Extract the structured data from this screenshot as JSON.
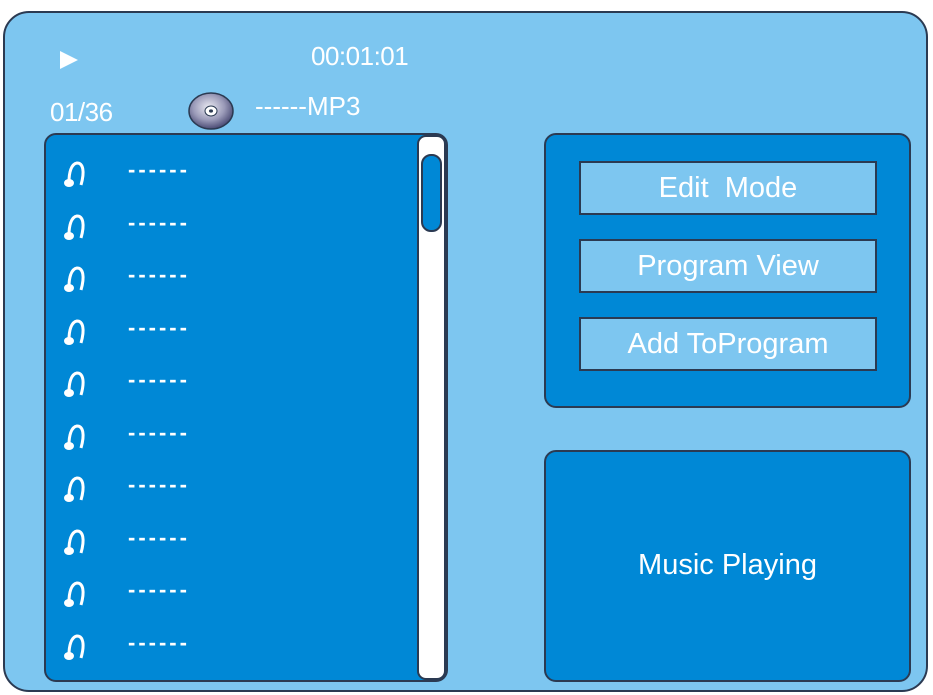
{
  "header": {
    "play_icon": "play-icon",
    "time": "00:01:01",
    "track": "01/36",
    "disc_icon": "cd-disc-icon",
    "format": "------MP3"
  },
  "playlist": {
    "items": [
      {
        "icon": "music-note-icon",
        "label": "------"
      },
      {
        "icon": "music-note-icon",
        "label": "------"
      },
      {
        "icon": "music-note-icon",
        "label": "------"
      },
      {
        "icon": "music-note-icon",
        "label": "------"
      },
      {
        "icon": "music-note-icon",
        "label": "------"
      },
      {
        "icon": "music-note-icon",
        "label": "------"
      },
      {
        "icon": "music-note-icon",
        "label": "------"
      },
      {
        "icon": "music-note-icon",
        "label": "------"
      },
      {
        "icon": "music-note-icon",
        "label": "------"
      },
      {
        "icon": "music-note-icon",
        "label": "------"
      }
    ]
  },
  "menu": {
    "edit_mode": "Edit  Mode",
    "program_view": "Program View",
    "add_to_program": "Add ToProgram"
  },
  "status": {
    "text": "Music Playing"
  },
  "colors": {
    "background": "#7dc6f0",
    "panel": "#0088d6",
    "border": "#2b3a52",
    "text": "#ffffff"
  }
}
